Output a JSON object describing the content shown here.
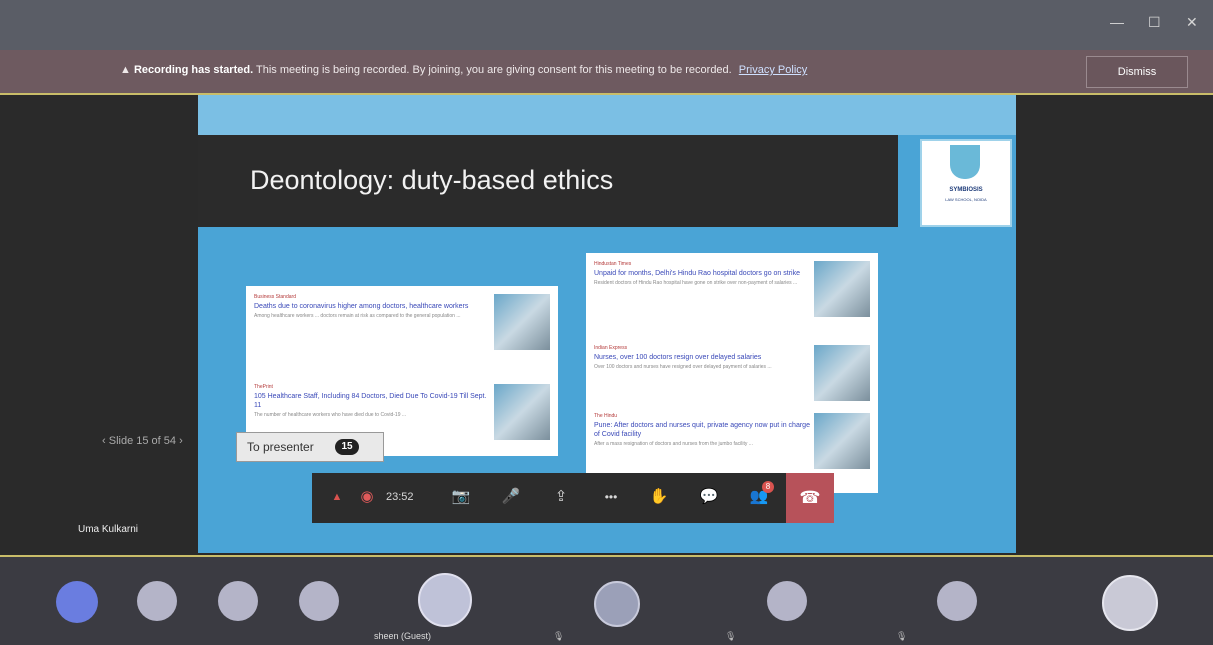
{
  "window": {
    "minimize": "—",
    "maximize": "☐",
    "close": "✕"
  },
  "banner": {
    "warning_icon": "▲",
    "bold": "Recording has started.",
    "message": "This meeting is being recorded. By joining, you are giving consent for this meeting to be recorded.",
    "link": "Privacy Policy",
    "dismiss": "Dismiss"
  },
  "slide": {
    "title": "Deontology: duty-based ethics",
    "logo_line1": "SYMBIOSIS",
    "logo_line2": "LAW SCHOOL, NOIDA",
    "left_cards": [
      {
        "source": "Business Standard",
        "headline": "Deaths due to coronavirus higher among doctors, healthcare workers",
        "snippet": "Among healthcare workers ... doctors remain at risk as compared to the general population ..."
      },
      {
        "source": "ThePrint",
        "headline": "105 Healthcare Staff, Including 84 Doctors, Died Due To Covid-19 Till Sept. 11",
        "snippet": "The number of healthcare workers who have died due to Covid-19 ..."
      }
    ],
    "right_cards": [
      {
        "source": "Hindustan Times",
        "headline": "Unpaid for months, Delhi's Hindu Rao hospital doctors go on strike",
        "snippet": "Resident doctors of Hindu Rao hospital have gone on strike over non-payment of salaries ..."
      },
      {
        "source": "Indian Express",
        "headline": "Nurses, over 100 doctors resign over delayed salaries",
        "snippet": "Over 100 doctors and nurses have resigned over delayed payment of salaries ..."
      },
      {
        "source": "The Hindu",
        "headline": "Pune: After doctors and nurses quit, private agency now put in charge of Covid facility",
        "snippet": "After a mass resignation of doctors and nurses from the jumbo facility ..."
      }
    ],
    "counter": "Slide 15 of 54"
  },
  "presenter": {
    "label": "To presenter",
    "count": "15"
  },
  "toolbar": {
    "timer": "23:52",
    "warn_icon": "▲",
    "record_icon": "◉",
    "camera_icon": "📷",
    "mic_icon": "🎤",
    "share_icon": "⇪",
    "more_icon": "•••",
    "hand_icon": "✋",
    "chat_icon": "💬",
    "people_icon": "👥",
    "people_badge": "8",
    "hangup_icon": "☎"
  },
  "presenter_name": "Uma Kulkarni",
  "participants": [
    {
      "name": ""
    },
    {
      "name": ""
    },
    {
      "name": ""
    },
    {
      "name": ""
    },
    {
      "name": "sheen (Guest)"
    },
    {
      "name": ""
    },
    {
      "name": ""
    },
    {
      "name": ""
    },
    {
      "name": ""
    }
  ],
  "colors": {
    "banner": "#6e5a60",
    "slide_bg": "#4aa4d6",
    "hangup": "#b7525a",
    "accent_line": "#c9bd69",
    "avatar_first": "#6a7de0",
    "avatar": "#b4b4c8"
  }
}
